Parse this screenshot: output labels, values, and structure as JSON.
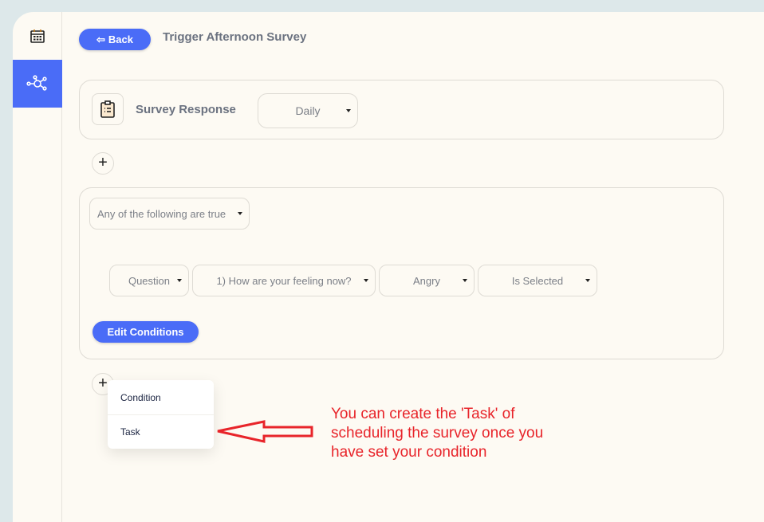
{
  "header": {
    "back_label": "Back",
    "title": "Trigger Afternoon Survey"
  },
  "sidebar": {
    "items": [
      {
        "icon": "calendar-icon",
        "active": false
      },
      {
        "icon": "workflow-icon",
        "active": true
      }
    ]
  },
  "trigger": {
    "label": "Survey Response",
    "frequency": "Daily"
  },
  "condition": {
    "match": "Any of the following are true",
    "row": {
      "type": "Question",
      "question": "1) How are your feeling now?",
      "answer": "Angry",
      "operator": "Is Selected"
    },
    "edit_label": "Edit Conditions"
  },
  "add_menu": {
    "items": [
      "Condition",
      "Task"
    ]
  },
  "annotation": {
    "text": "You can create the 'Task' of scheduling the survey once you have set your condition",
    "color": "#e8242a"
  },
  "colors": {
    "accent": "#4a6cf7"
  }
}
